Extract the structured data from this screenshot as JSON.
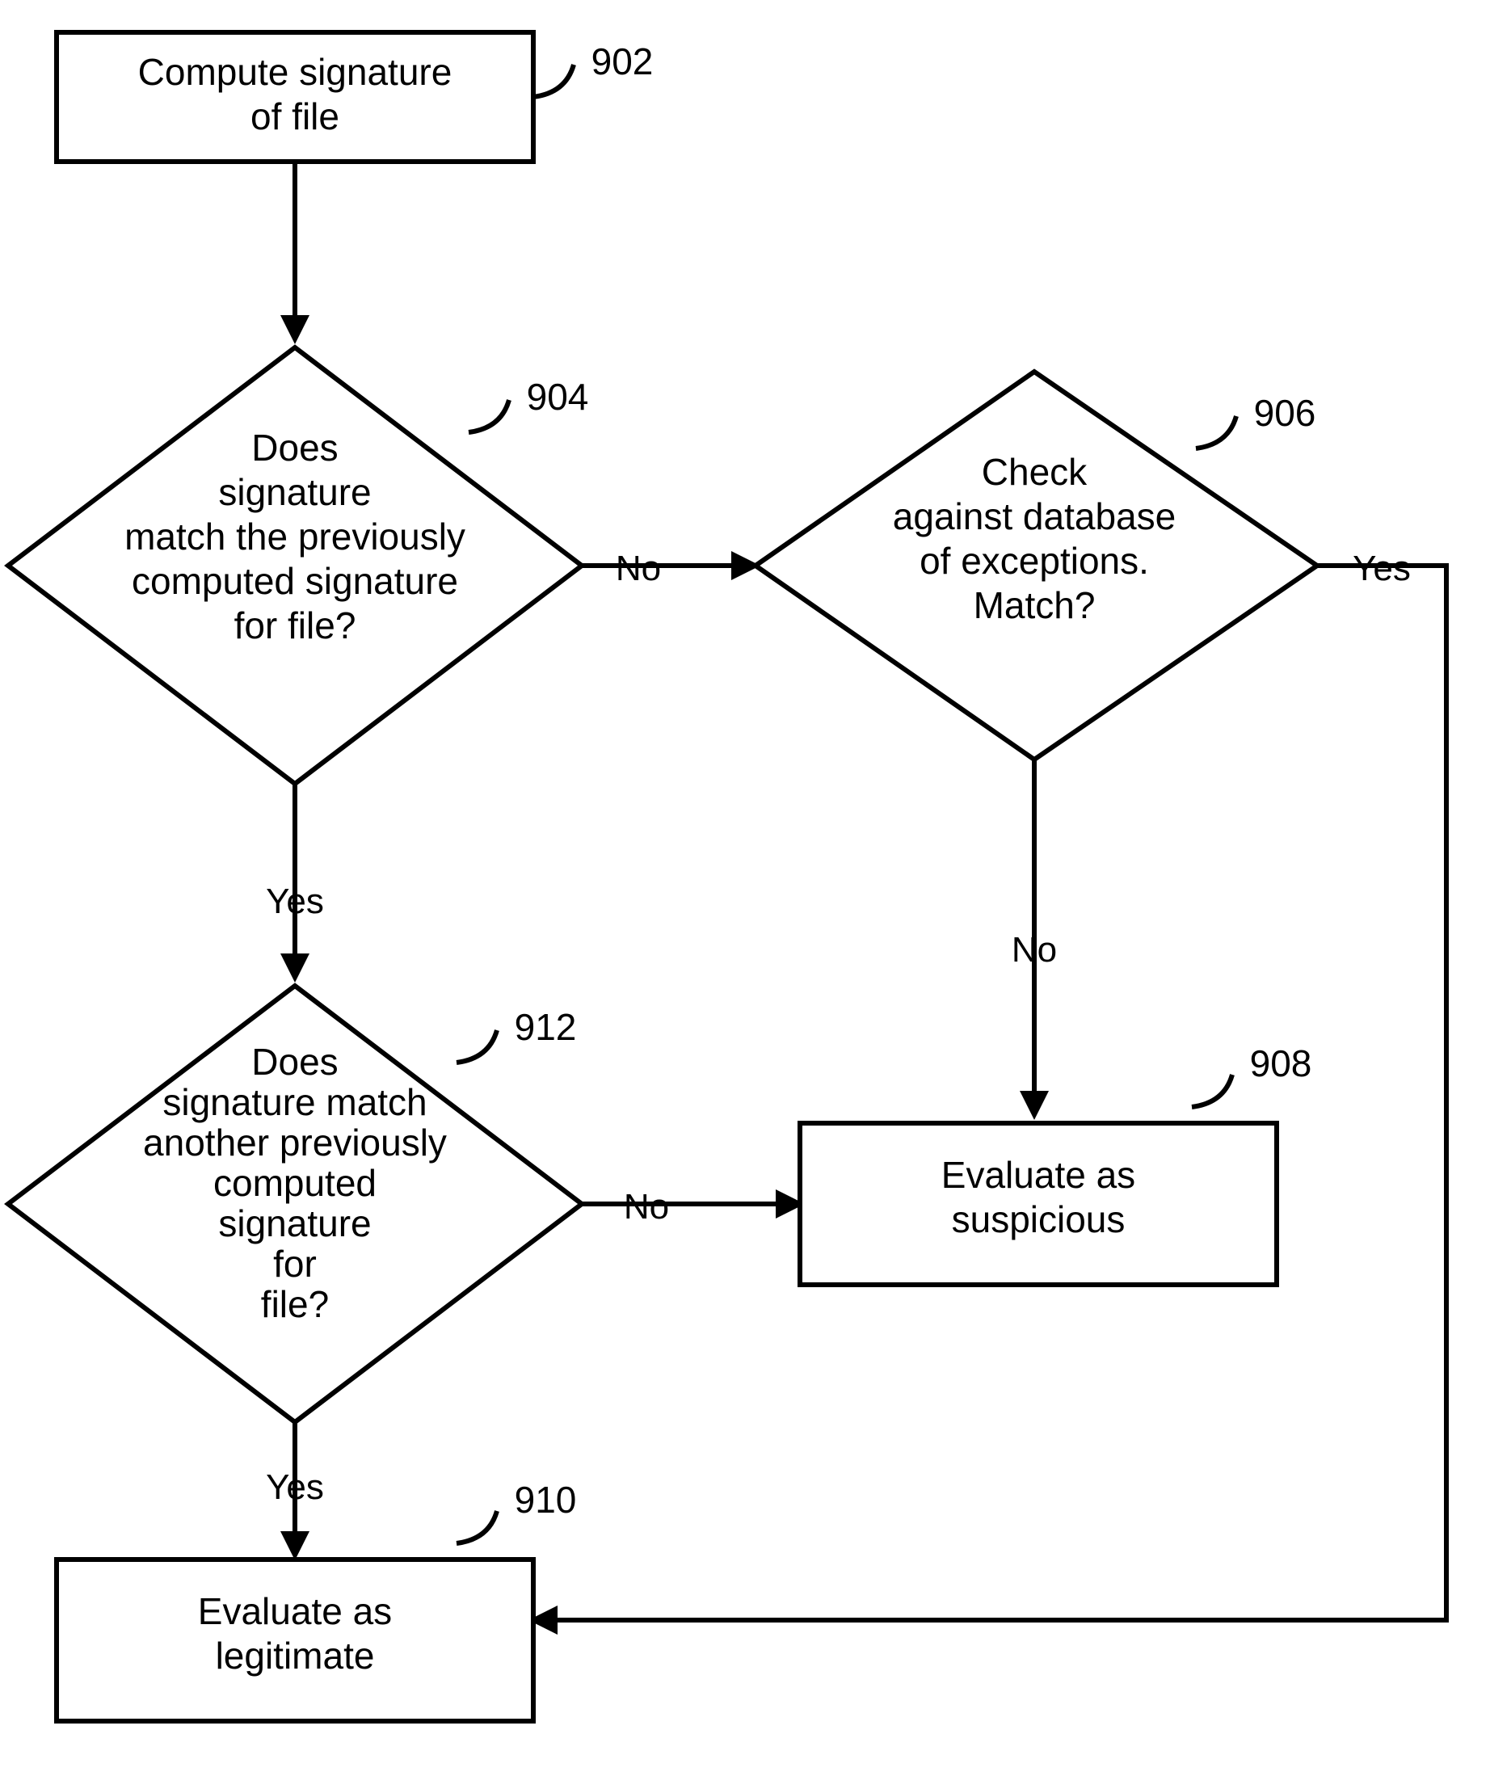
{
  "nodes": {
    "n902": {
      "ref": "902",
      "lines": [
        "Compute signature",
        "of file"
      ]
    },
    "n904": {
      "ref": "904",
      "lines": [
        "Does",
        "signature",
        "match the previously",
        "computed signature",
        "for file?"
      ]
    },
    "n906": {
      "ref": "906",
      "lines": [
        "Check",
        "against database",
        "of exceptions.",
        "Match?"
      ]
    },
    "n912": {
      "ref": "912",
      "lines": [
        "Does",
        "signature match",
        "another previously",
        "computed",
        "signature",
        "for",
        "file?"
      ]
    },
    "n908": {
      "ref": "908",
      "lines": [
        "Evaluate as",
        "suspicious"
      ]
    },
    "n910": {
      "ref": "910",
      "lines": [
        "Evaluate as",
        "legitimate"
      ]
    }
  },
  "edgeLabels": {
    "e904no": "No",
    "e904yes": "Yes",
    "e906yes": "Yes",
    "e906no": "No",
    "e912no": "No",
    "e912yes": "Yes"
  }
}
